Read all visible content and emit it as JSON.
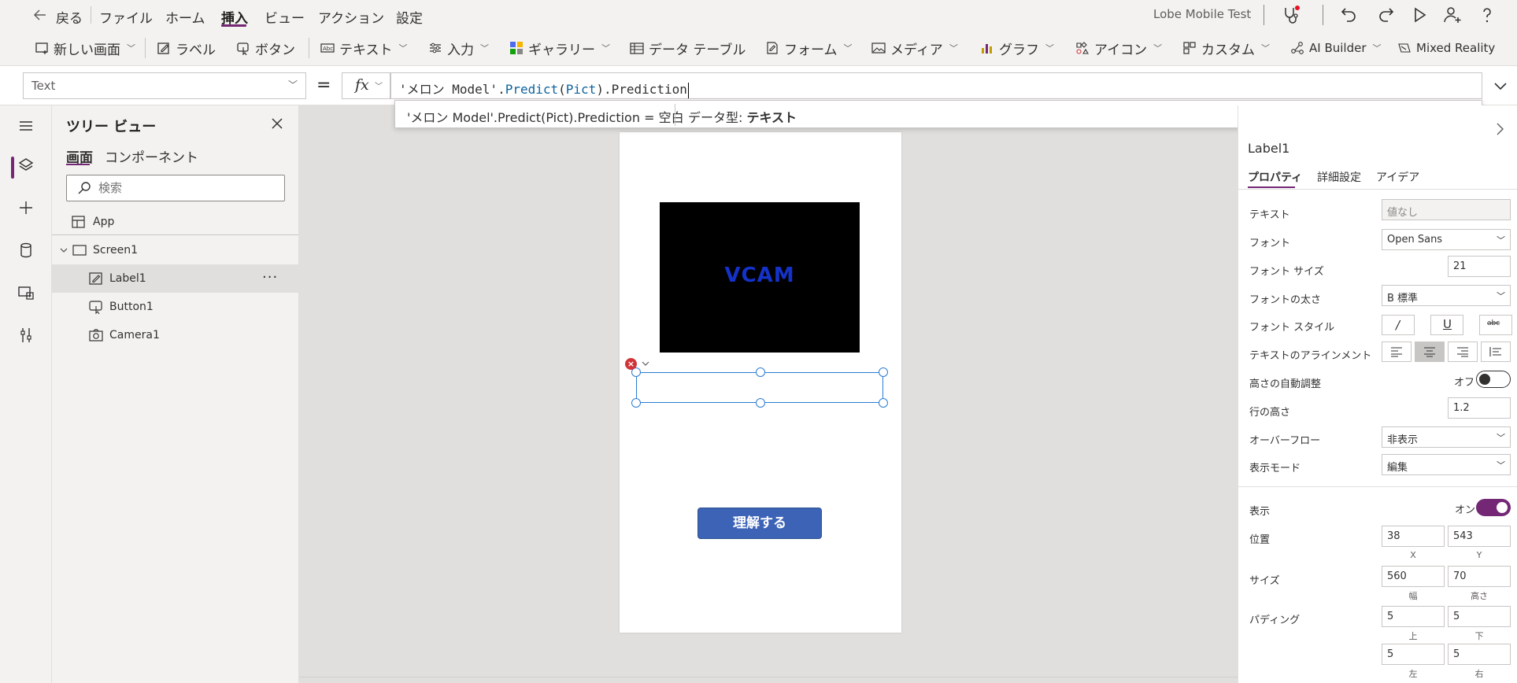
{
  "menubar": {
    "back_label": "戻る",
    "items": [
      "ファイル",
      "ホーム",
      "挿入",
      "ビュー",
      "アクション",
      "設定"
    ],
    "active_index": 2,
    "app_name": "Lobe Mobile Test"
  },
  "ribbon": {
    "new_screen": "新しい画面",
    "label": "ラベル",
    "button": "ボタン",
    "text": "テキスト",
    "input": "入力",
    "gallery": "ギャラリー",
    "data_table": "データ テーブル",
    "form": "フォーム",
    "media": "メディア",
    "chart": "グラフ",
    "icons": "アイコン",
    "custom": "カスタム",
    "ai_builder": "AI Builder",
    "mixed_reality": "Mixed Reality"
  },
  "formula": {
    "property": "Text",
    "equals": "=",
    "fx": "fx",
    "part1": "'メロン Model'.",
    "fn1": "Predict",
    "part2": "(",
    "fn2": "Pict",
    "part3": ").Prediction",
    "tip_expr": "'メロン Model'.Predict(Pict).Prediction  =  空白",
    "tip_type_label": "データ型: ",
    "tip_type_value": "テキスト"
  },
  "tree": {
    "title": "ツリー ビュー",
    "tab_screens": "画面",
    "tab_components": "コンポーネント",
    "search_placeholder": "検索",
    "app": "App",
    "screen1": "Screen1",
    "label1": "Label1",
    "button1": "Button1",
    "camera1": "Camera1",
    "more": "···"
  },
  "canvas": {
    "camera_text": "VCAM",
    "button_text": "理解する"
  },
  "props": {
    "control_name": "Label1",
    "tabs": [
      "プロパティ",
      "詳細設定",
      "アイデア"
    ],
    "text_label": "テキスト",
    "text_value": "値なし",
    "font_label": "フォント",
    "font_value": "Open Sans",
    "font_size_label": "フォント サイズ",
    "font_size_value": "21",
    "font_weight_label": "フォントの太さ",
    "font_weight_value": "B 標準",
    "font_style_label": "フォント スタイル",
    "align_label": "テキストのアラインメント",
    "autoheight_label": "高さの自動調整",
    "autoheight_state": "オフ",
    "line_height_label": "行の高さ",
    "line_height_value": "1.2",
    "overflow_label": "オーバーフロー",
    "overflow_value": "非表示",
    "display_mode_label": "表示モード",
    "display_mode_value": "編集",
    "visible_label": "表示",
    "visible_state": "オン",
    "position_label": "位置",
    "pos_x": "38",
    "pos_y": "543",
    "x_cap": "X",
    "y_cap": "Y",
    "size_label": "サイズ",
    "width": "560",
    "height": "70",
    "width_cap": "幅",
    "height_cap": "高さ",
    "padding_label": "パディング",
    "pad_top": "5",
    "pad_bottom": "5",
    "pad_left": "5",
    "pad_right": "5",
    "top_cap": "上",
    "bottom_cap": "下",
    "left_cap": "左",
    "right_cap": "右"
  },
  "colors": {
    "accent": "#742774",
    "selection": "#2b7cd3",
    "button": "#3c63b6",
    "error": "#d13438"
  }
}
